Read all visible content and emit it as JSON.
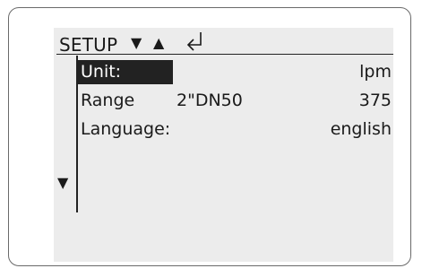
{
  "header": {
    "title": "SETUP",
    "scroll_down_glyph": "▼",
    "scroll_up_glyph": "▲",
    "enter_icon": "enter-return-icon"
  },
  "menu": {
    "items": [
      {
        "label": "Unit:",
        "mid": "",
        "value": "lpm",
        "selected": true
      },
      {
        "label": "Range",
        "mid": "2\"DN50",
        "value": "375",
        "selected": false
      },
      {
        "label": "Language:",
        "mid": "",
        "value": "english",
        "selected": false
      }
    ],
    "more_below_glyph": "▼"
  }
}
